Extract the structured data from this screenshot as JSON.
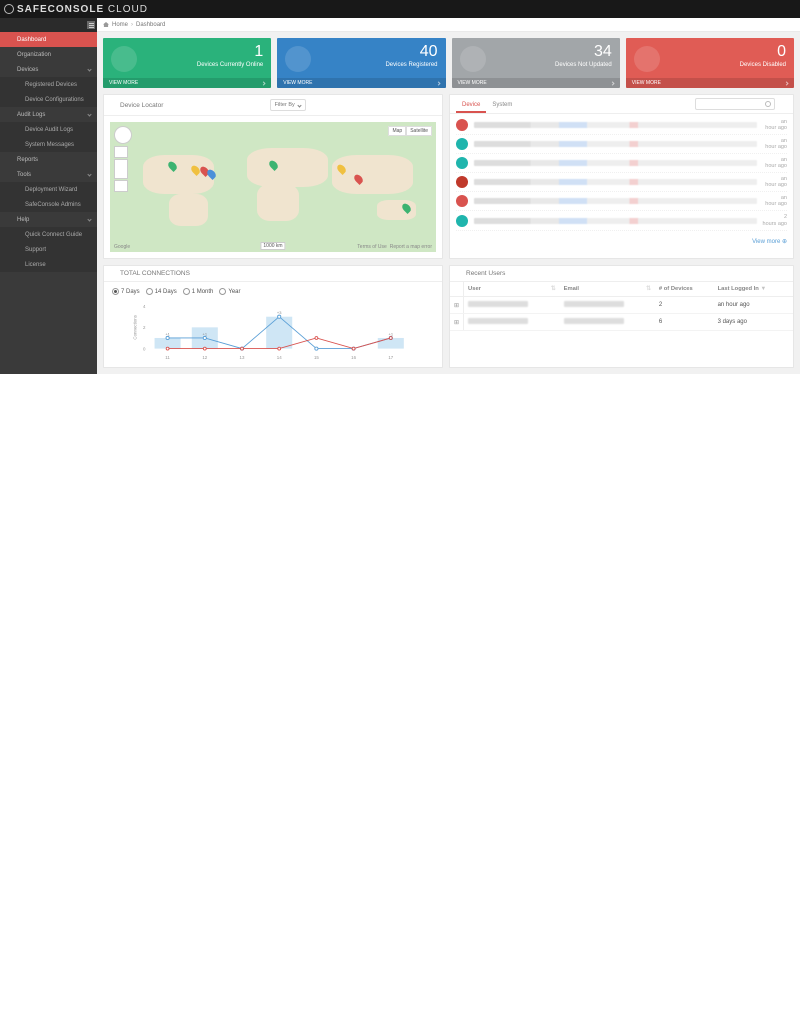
{
  "brand": {
    "name_main": "SAFECONSOLE",
    "name_sub": "CLOUD"
  },
  "breadcrumbs": {
    "home": "Home",
    "current": "Dashboard"
  },
  "sidebar": {
    "dashboard": "Dashboard",
    "organization": "Organization",
    "devices": "Devices",
    "devices_sub": {
      "registered": "Registered Devices",
      "configs": "Device Configurations"
    },
    "audit": "Audit Logs",
    "audit_sub": {
      "device_logs": "Device Audit Logs",
      "sys_msgs": "System Messages"
    },
    "reports": "Reports",
    "tools": "Tools",
    "tools_sub": {
      "wizard": "Deployment Wizard",
      "admins": "SafeConsole Admins"
    },
    "help": "Help",
    "help_sub": {
      "guide": "Quick Connect Guide",
      "support": "Support",
      "license": "License"
    }
  },
  "cards": [
    {
      "value": "1",
      "label": "Devices Currently Online",
      "action": "VIEW MORE"
    },
    {
      "value": "40",
      "label": "Devices Registered",
      "action": "VIEW MORE"
    },
    {
      "value": "34",
      "label": "Devices Not Updated",
      "action": "VIEW MORE"
    },
    {
      "value": "0",
      "label": "Devices Disabled",
      "action": "VIEW MORE"
    }
  ],
  "locator": {
    "title": "Device Locator",
    "filter": "Filter By",
    "map": "Map",
    "sat": "Satellite",
    "scale": "1000 km",
    "cred": "Google",
    "terms": "Terms of Use",
    "report": "Report a map error"
  },
  "activity": {
    "tabs": {
      "device": "Device",
      "system": "System"
    },
    "items": [
      {
        "color": "d-red",
        "time": "an hour ago"
      },
      {
        "color": "d-teal",
        "time": "an hour ago"
      },
      {
        "color": "d-teal",
        "time": "an hour ago"
      },
      {
        "color": "d-mag",
        "time": "an hour ago"
      },
      {
        "color": "d-red",
        "time": "an hour ago"
      },
      {
        "color": "d-teal",
        "time": "2 hours ago"
      }
    ],
    "viewmore": "View more"
  },
  "connections": {
    "title": "TOTAL CONNECTIONS",
    "ranges": {
      "d7": "7 Days",
      "d14": "14 Days",
      "m1": "1 Month",
      "y": "Year"
    },
    "ylabel": "Connections"
  },
  "chart_data": {
    "type": "bar",
    "title": "TOTAL CONNECTIONS",
    "xlabel": "",
    "ylabel": "Connections",
    "ylim": [
      0,
      4
    ],
    "categories": [
      "11",
      "12",
      "13",
      "14",
      "15",
      "16",
      "17"
    ],
    "series": [
      {
        "name": "connections",
        "values": [
          1,
          2,
          0,
          3,
          0,
          0,
          1
        ]
      },
      {
        "name": "line_a",
        "values": [
          1,
          1,
          0,
          3,
          0,
          0,
          1
        ]
      },
      {
        "name": "line_b",
        "values": [
          0,
          0,
          0,
          0,
          1,
          0,
          1
        ]
      }
    ],
    "point_labels": [
      "+1",
      "+1",
      "",
      "+3",
      "",
      "",
      "+1"
    ]
  },
  "recent": {
    "title": "Recent Users",
    "cols": {
      "user": "User",
      "email": "Email",
      "devices": "# of Devices",
      "last": "Last Logged In"
    },
    "rows": [
      {
        "devices": "2",
        "last": "an hour ago"
      },
      {
        "devices": "6",
        "last": "3 days ago"
      }
    ]
  }
}
